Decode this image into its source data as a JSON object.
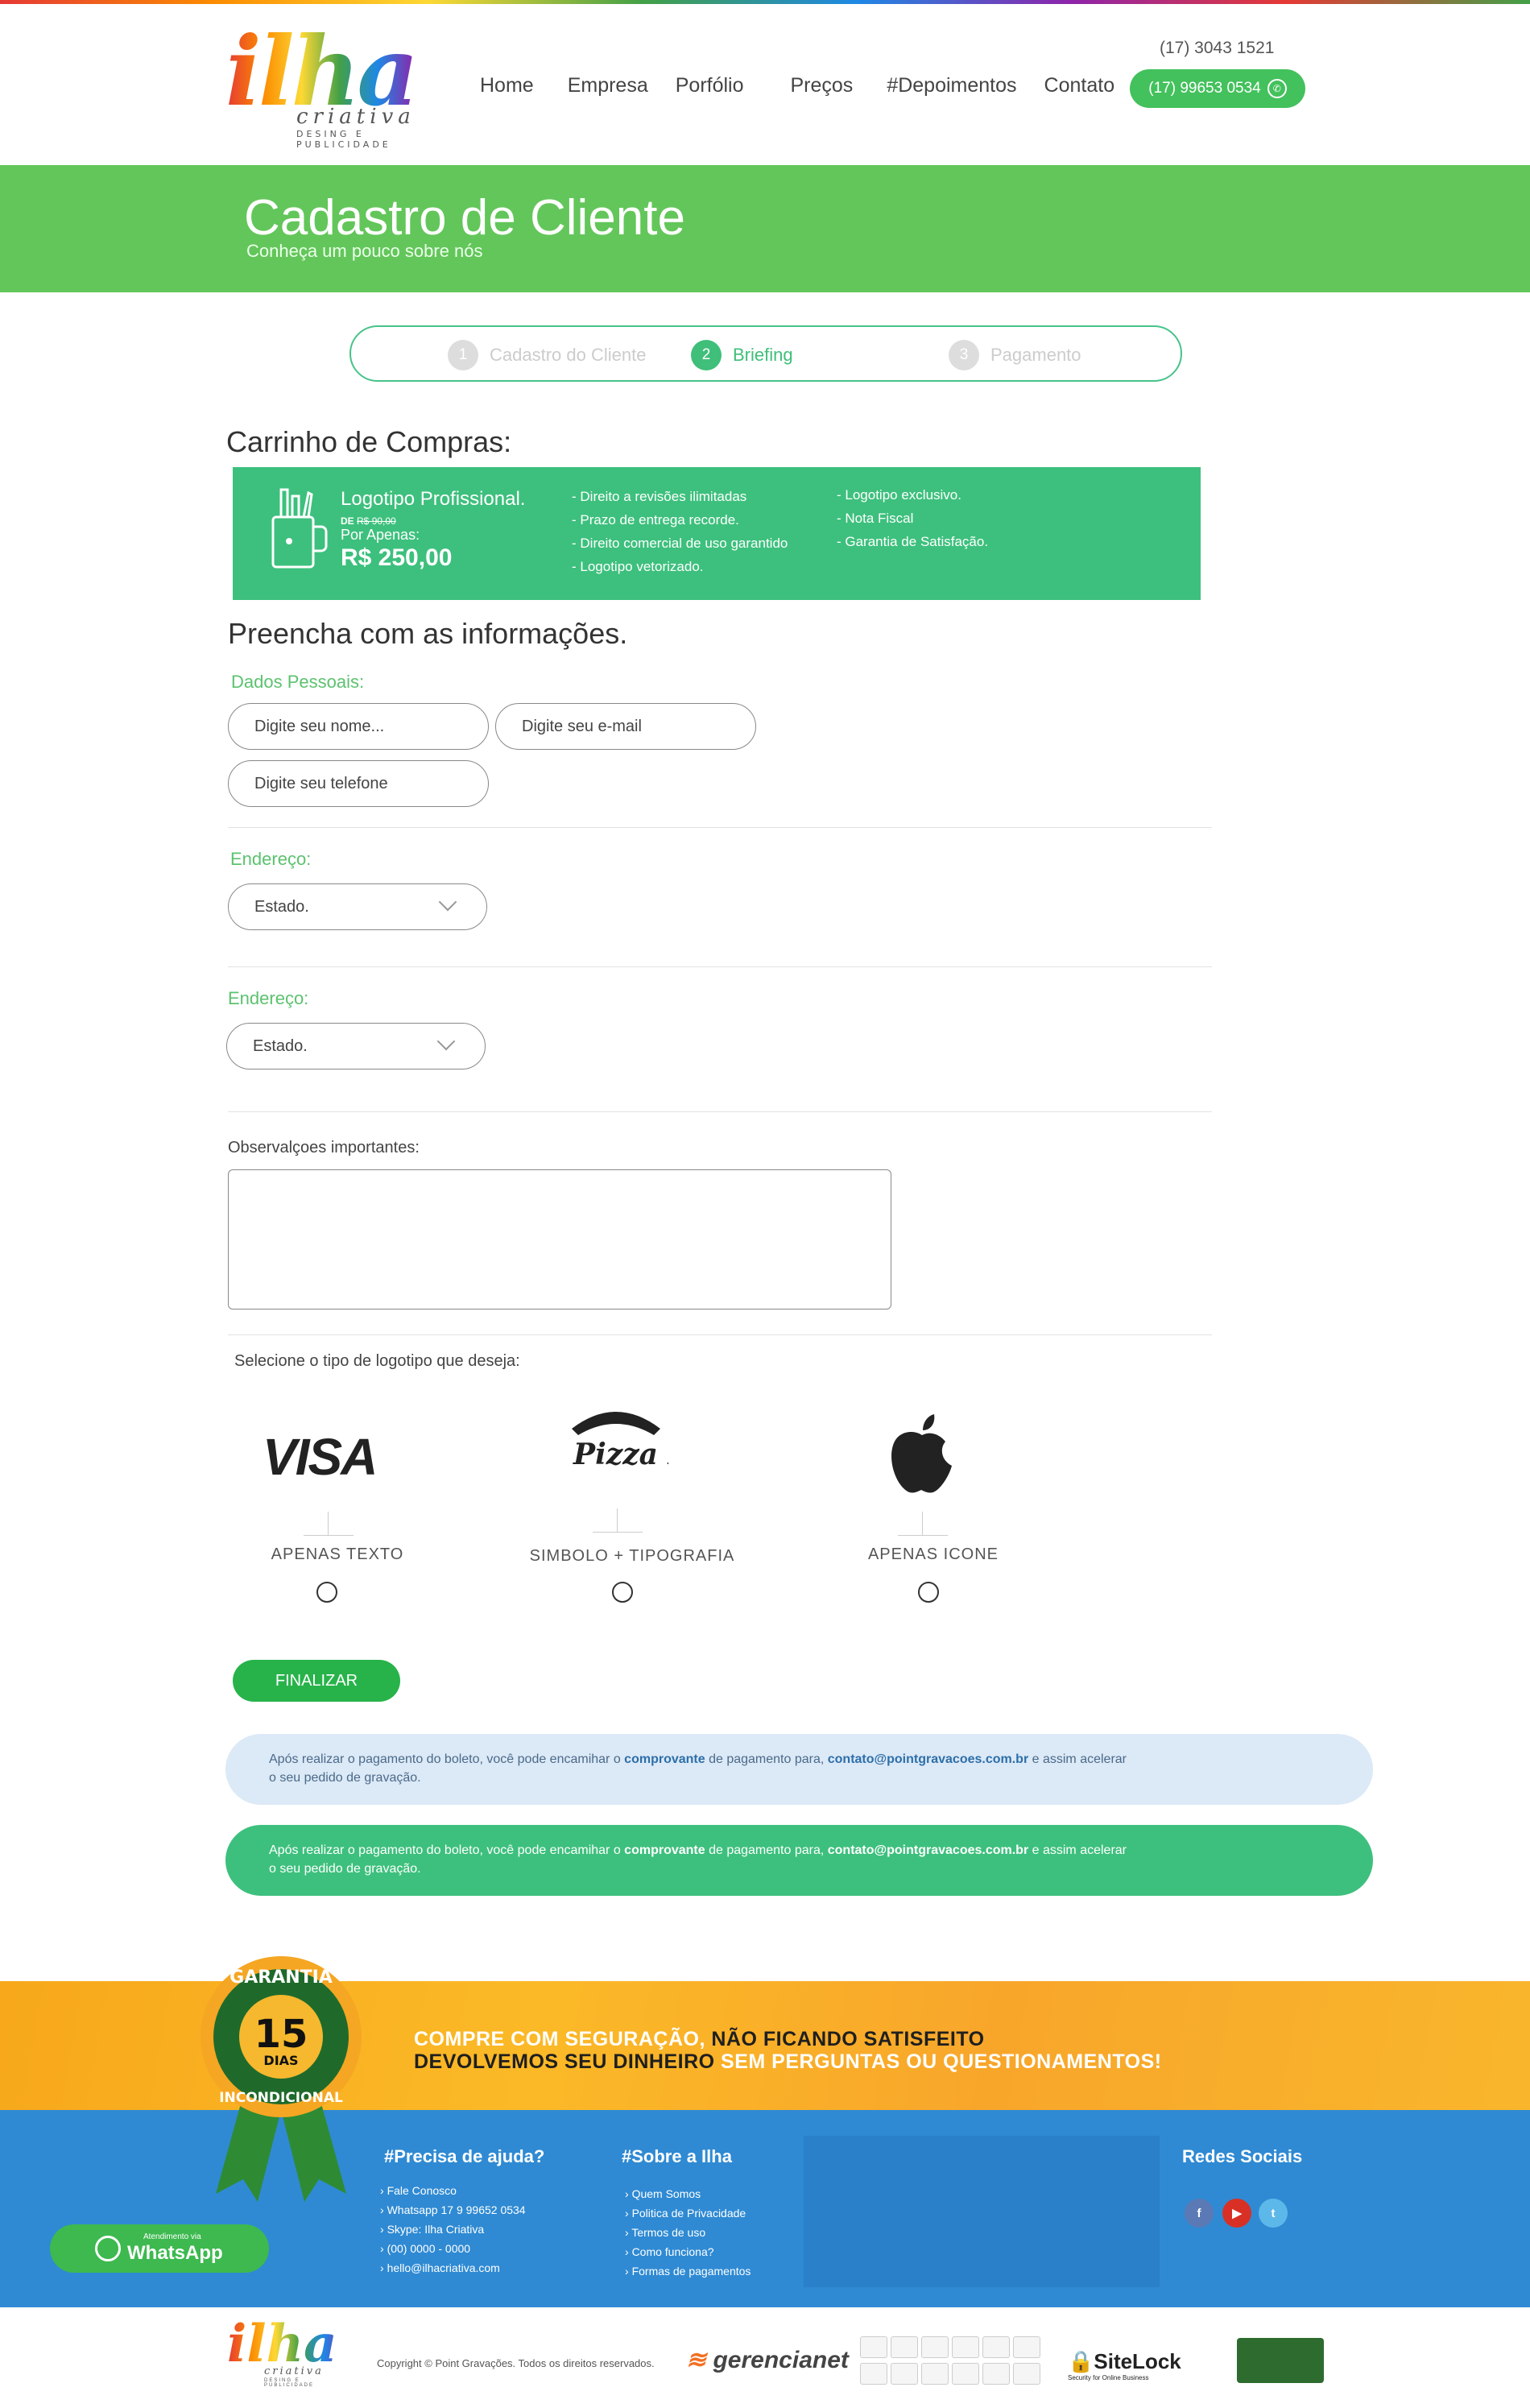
{
  "brand": {
    "logo_main": "ilha",
    "logo_sub": "criativa",
    "logo_tag": "DESING E PUBLICIDADE"
  },
  "nav": [
    "Home",
    "Empresa",
    "Porfólio",
    "Preços",
    "#Depoimentos",
    "Contato"
  ],
  "header": {
    "phone": "(17) 3043 1521",
    "whatsapp": "(17) 99653 0534"
  },
  "banner": {
    "title": "Cadastro de Cliente",
    "subtitle": "Conheça um pouco sobre nós"
  },
  "steps": [
    {
      "num": "1",
      "label": "Cadastro do Cliente",
      "active": false
    },
    {
      "num": "2",
      "label": "Briefing",
      "active": true
    },
    {
      "num": "3",
      "label": "Pagamento",
      "active": false
    }
  ],
  "cart": {
    "title": "Carrinho de Compras:",
    "product": "Logotipo Profissional.",
    "old_prefix": "DE",
    "old_price": "R$ 90,00",
    "price_label": "Por Apenas:",
    "price": "R$ 250,00",
    "features_col1": [
      "- Direito a revisões ilimitadas",
      "- Prazo de entrega recorde.",
      "- Direito comercial de uso garantido",
      "- Logotipo vetorizado."
    ],
    "features_col2": [
      "- Logotipo exclusivo.",
      "- Nota Fiscal",
      "- Garantia de Satisfação."
    ]
  },
  "form": {
    "title": "Preencha com as informações.",
    "personal_label": "Dados Pessoais:",
    "name_placeholder": "Digite seu nome...",
    "email_placeholder": "Digite seu e-mail",
    "phone_placeholder": "Digite seu telefone",
    "address1_label": "Endereço:",
    "address1_value": "Estado.",
    "address2_label": "Endereço:",
    "address2_value": "Estado.",
    "notes_label": "Observalçoes importantes:",
    "logo_type_label": "Selecione o tipo de logotipo que deseja:",
    "options": [
      {
        "example": "VISA",
        "label": "APENAS TEXTO"
      },
      {
        "example": "Pizza Hut",
        "label": "SIMBOLO + TIPOGRAFIA"
      },
      {
        "example": "apple-icon",
        "label": "APENAS ICONE"
      }
    ],
    "submit": "FINALIZAR"
  },
  "notice": {
    "part1": "Após realizar o pagamento do boleto, você pode encamihar o ",
    "bold1": "comprovante",
    "part2": " de pagamento para, ",
    "email": "contato@pointgravacoes.com.br",
    "part3": " e assim acelerar",
    "line2": "o seu pedido de gravação."
  },
  "guarantee": {
    "seal_top": "GARANTIA",
    "seal_num": "15",
    "seal_days": "DIAS",
    "seal_bottom": "INCONDICIONAL",
    "l1a": "COMPRE COM SEGURAÇÃO,",
    "l1b": " NÃO FICANDO SATISFEITO",
    "l2a": "DEVOLVEMOS SEU DINHEIRO",
    "l2b": " SEM PERGUNTAS OU QUESTIONAMENTOS!"
  },
  "footer": {
    "help_title": "#Precisa de ajuda?",
    "help_items": [
      "Fale Conosco",
      "Whatsapp 17 9 99652 0534",
      "Skype: Ilha Criativa",
      "(00) 0000 - 0000",
      "hello@ilhacriativa.com"
    ],
    "about_title": "#Sobre a Ilha",
    "about_items": [
      "Quem Somos",
      "Politica de Privacidade",
      "Termos de uso",
      "Como funciona?",
      "Formas de pagamentos"
    ],
    "social_title": "Redes Sociais",
    "social": [
      "facebook-icon",
      "youtube-icon",
      "twitter-icon"
    ],
    "whatsapp_small": "Atendimento via",
    "whatsapp_big": "WhatsApp"
  },
  "bottom": {
    "copyright": "Copyright © Point Gravações. Todos os direitos reservados.",
    "gerencianet": "gerencianet",
    "sitelock": "SiteLock",
    "sitelock_sub": "Security for Online Business"
  },
  "colors": {
    "green": "#63c65a",
    "teal": "#3dc07d",
    "blue": "#2f8ad3",
    "orange": "#f7a81b",
    "button": "#27b34a"
  }
}
